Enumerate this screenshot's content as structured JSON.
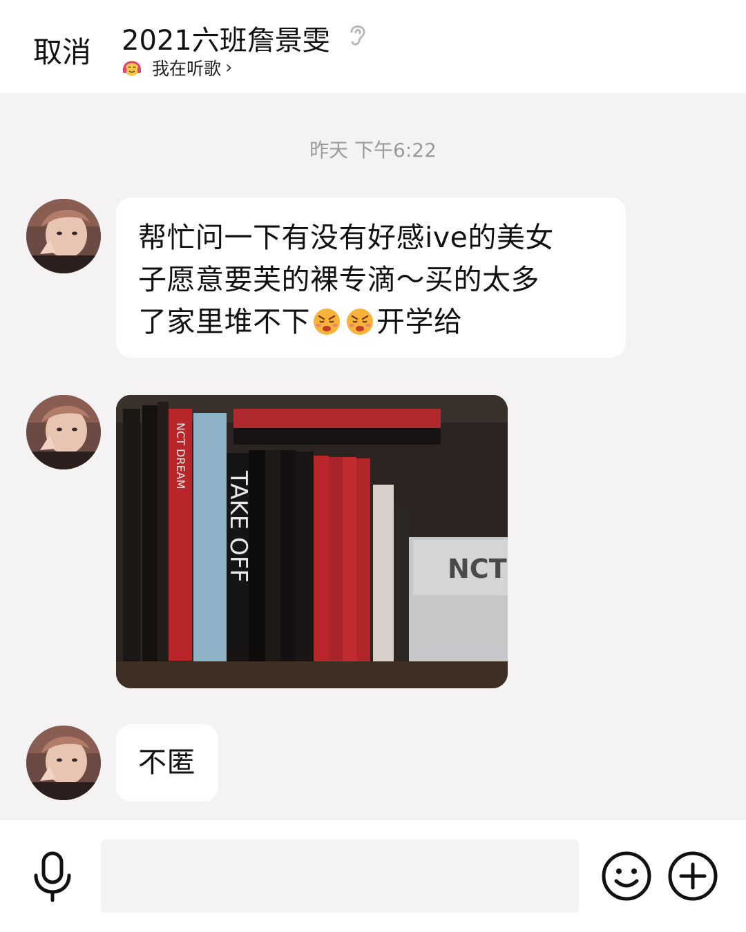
{
  "header": {
    "cancel_label": "取消",
    "title": "2021六班詹景雯",
    "status_text": "我在听歌",
    "status_chevron": "›",
    "ear_icon": "ear-icon",
    "status_icon": "headphone-emoji-icon"
  },
  "chat": {
    "timestamp": "昨天 下午6:22",
    "messages": [
      {
        "type": "text",
        "lines": [
          "帮忙问一下有没有好感ive的美女",
          "子愿意要芙的裸专滴～买的太多",
          "了家里堆不下"
        ],
        "line3_suffix": "开学给",
        "inline_emoji": "frowning-face-emoji"
      },
      {
        "type": "image",
        "description_icon": "album-shelf-photo"
      },
      {
        "type": "text",
        "text": "不匿"
      }
    ]
  },
  "input_bar": {
    "placeholder": "",
    "mic_icon": "microphone-icon",
    "emoji_icon": "smiley-icon",
    "plus_icon": "plus-icon"
  },
  "colors": {
    "background": "#f4f2f3",
    "bubble": "#ffffff",
    "timestamp": "#9a9a9a",
    "input_field": "#f3f3f3"
  }
}
